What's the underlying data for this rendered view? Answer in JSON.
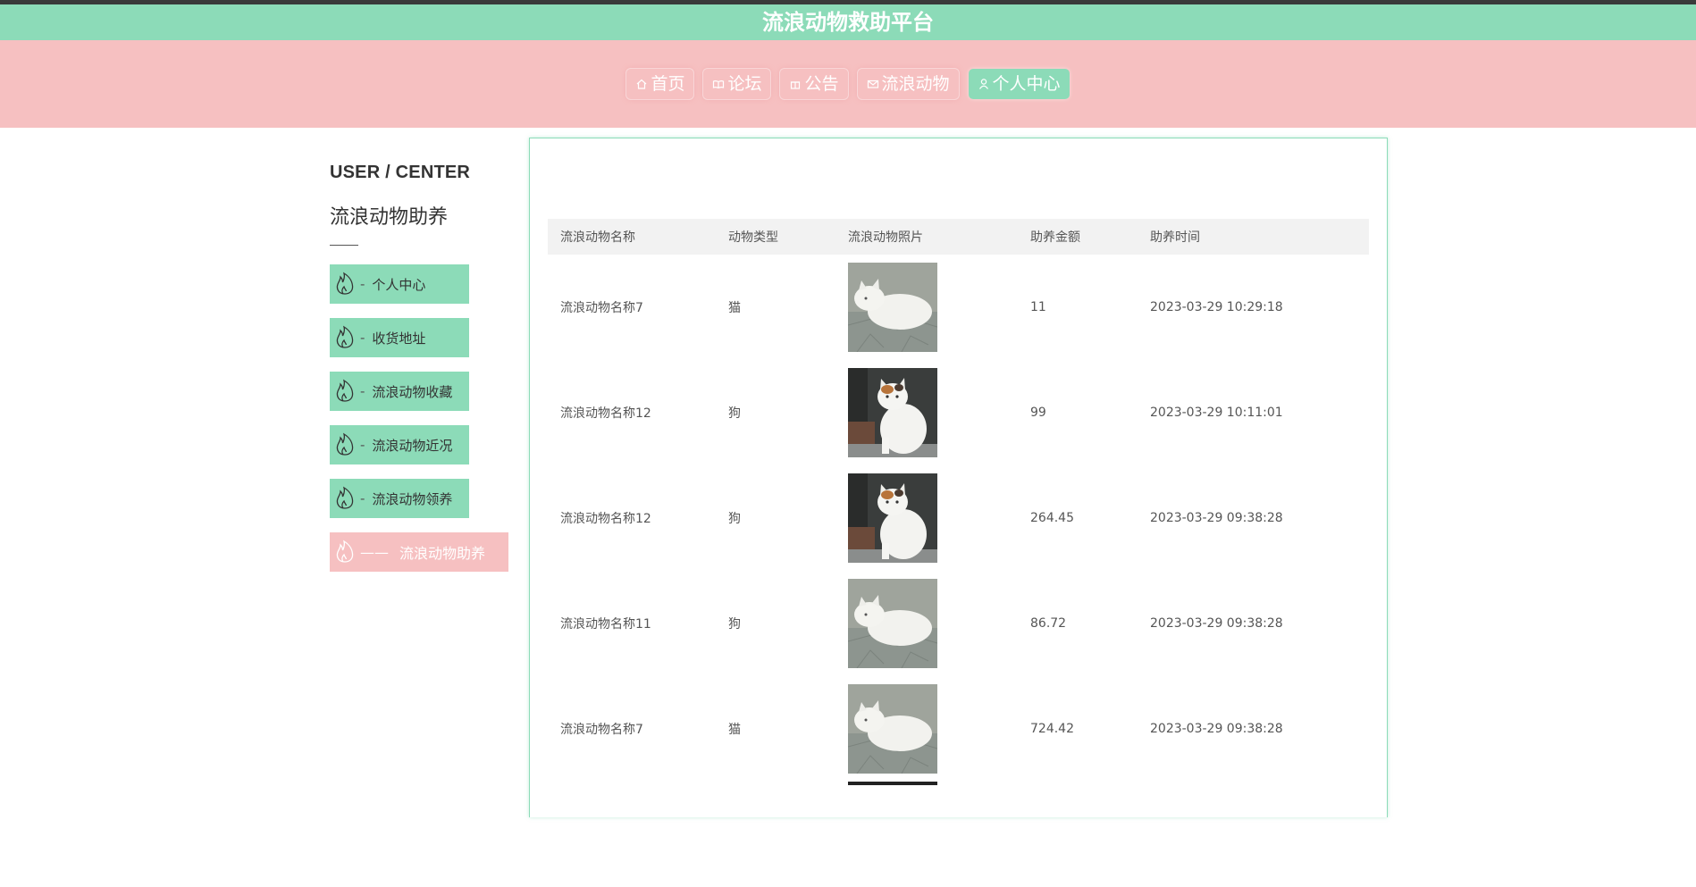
{
  "header": {
    "title": "流浪动物救助平台"
  },
  "nav": {
    "items": [
      {
        "label": "首页",
        "icon": "home-icon"
      },
      {
        "label": "论坛",
        "icon": "book-icon"
      },
      {
        "label": "公告",
        "icon": "gift-icon"
      },
      {
        "label": "流浪动物",
        "icon": "mail-icon"
      },
      {
        "label": "个人中心",
        "icon": "user-icon",
        "active": true
      }
    ]
  },
  "sidebar": {
    "title_en": "USER / CENTER",
    "title_zh": "流浪动物助养",
    "items": [
      {
        "dash": "-",
        "label": "个人中心",
        "icon": "flame-icon"
      },
      {
        "dash": "-",
        "label": "收货地址",
        "icon": "flame-icon"
      },
      {
        "dash": "-",
        "label": "流浪动物收藏",
        "icon": "flame-icon"
      },
      {
        "dash": "-",
        "label": "流浪动物近况",
        "icon": "flame-icon"
      },
      {
        "dash": "-",
        "label": "流浪动物领养",
        "icon": "flame-icon"
      },
      {
        "dash": "——",
        "label": "流浪动物助养",
        "icon": "flame-icon",
        "active": true
      }
    ]
  },
  "table": {
    "headers": [
      "流浪动物名称",
      "动物类型",
      "流浪动物照片",
      "助养金额",
      "助养时间"
    ],
    "rows": [
      {
        "name": "流浪动物名称7",
        "type": "猫",
        "photo": "white-cat-lying",
        "amount": "11",
        "time": "2023-03-29 10:29:18"
      },
      {
        "name": "流浪动物名称12",
        "type": "狗",
        "photo": "white-cat-sitting",
        "amount": "99",
        "time": "2023-03-29 10:11:01"
      },
      {
        "name": "流浪动物名称12",
        "type": "狗",
        "photo": "white-cat-sitting",
        "amount": "264.45",
        "time": "2023-03-29 09:38:28"
      },
      {
        "name": "流浪动物名称11",
        "type": "狗",
        "photo": "white-cat-lying",
        "amount": "86.72",
        "time": "2023-03-29 09:38:28"
      },
      {
        "name": "流浪动物名称7",
        "type": "猫",
        "photo": "white-cat-lying",
        "amount": "724.42",
        "time": "2023-03-29 09:38:28"
      }
    ]
  },
  "colors": {
    "green": "#8cdbb8",
    "pink": "#f6c0c1"
  }
}
